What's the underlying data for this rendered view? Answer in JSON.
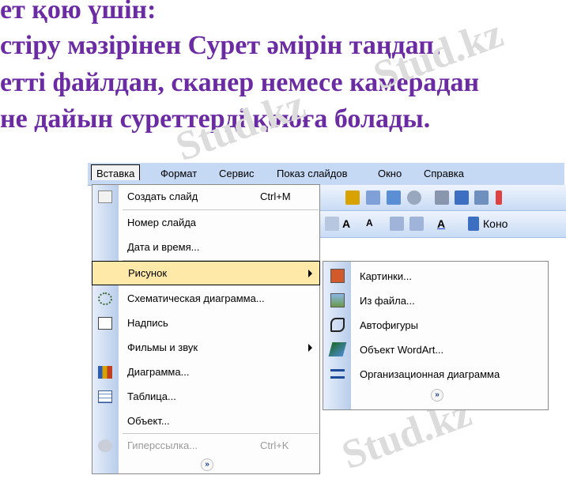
{
  "heading": {
    "line1": "ет қою үшін:",
    "line2": "стіру мәзірінен Сурет әмірін таңдап,",
    "line3": "етті файлдан, сканер немесе камерадан",
    "line4": "не дайын суреттерді қоюға болады."
  },
  "watermark": "Stud.kz",
  "menubar": [
    "Вставка",
    "Формат",
    "Сервис",
    "Показ слайдов",
    "Окно",
    "Справка"
  ],
  "toolbar": {
    "font_label": "Коно"
  },
  "insert_menu": {
    "items": [
      {
        "label": "Создать слайд",
        "shortcut": "Ctrl+M",
        "icon": "new-slide-icon"
      },
      {
        "label": "Номер слайда"
      },
      {
        "label": "Дата и время..."
      },
      {
        "label": "Рисунок",
        "submenu": true
      },
      {
        "label": "Схематическая диаграмма...",
        "icon": "diagram-icon"
      },
      {
        "label": "Надпись",
        "icon": "textbox-icon"
      },
      {
        "label": "Фильмы и звук",
        "submenu": true
      },
      {
        "label": "Диаграмма...",
        "icon": "chart-icon"
      },
      {
        "label": "Таблица...",
        "icon": "table-icon"
      },
      {
        "label": "Объект..."
      },
      {
        "label": "Гиперссылка...",
        "shortcut": "Ctrl+K",
        "icon": "hyperlink-icon",
        "disabled": true
      }
    ],
    "more": "»"
  },
  "picture_submenu": {
    "items": [
      {
        "label": "Картинки...",
        "icon": "clipart-icon"
      },
      {
        "label": "Из файла...",
        "icon": "picture-file-icon"
      },
      {
        "label": "Автофигуры",
        "icon": "autoshapes-icon"
      },
      {
        "label": "Объект WordArt...",
        "icon": "wordart-icon"
      },
      {
        "label": "Организационная диаграмма",
        "icon": "org-chart-icon"
      }
    ],
    "more": "»"
  },
  "colors": {
    "heading": "#6b2ba3",
    "highlight": "#ffe9a8",
    "menubar": "#c5d9f5"
  }
}
